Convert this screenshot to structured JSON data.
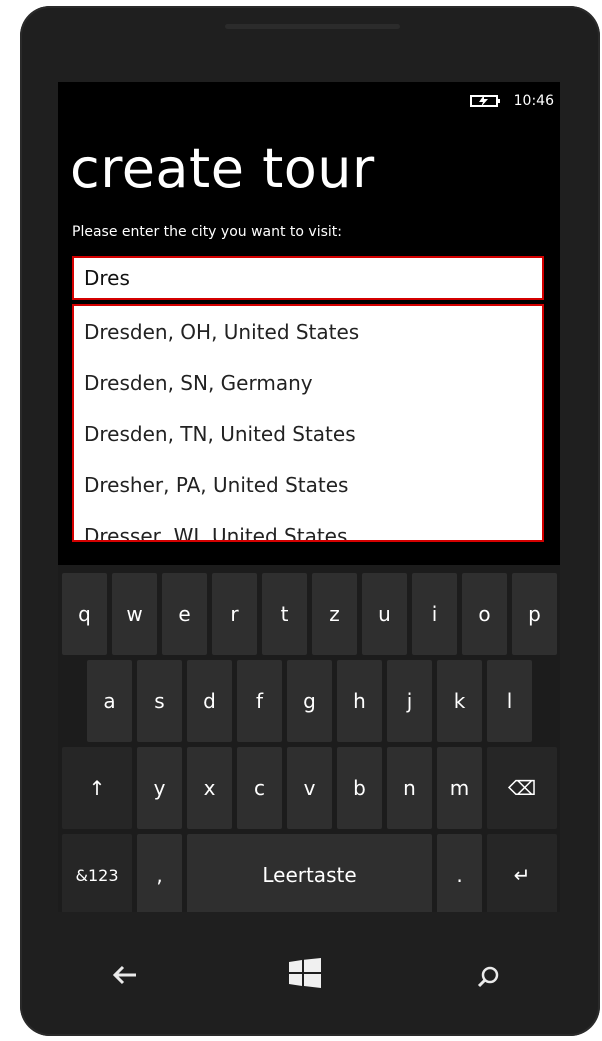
{
  "status": {
    "time": "10:46"
  },
  "page": {
    "title": "create tour",
    "prompt": "Please enter the city you want to visit:"
  },
  "search": {
    "value": "Dres"
  },
  "suggestions": [
    "Dresden, OH, United States",
    "Dresden, SN, Germany",
    "Dresden, TN, United States",
    "Dresher, PA, United States",
    "Dresser, WI, United States"
  ],
  "keyboard": {
    "row1": [
      "q",
      "w",
      "e",
      "r",
      "t",
      "z",
      "u",
      "i",
      "o",
      "p"
    ],
    "row2": [
      "a",
      "s",
      "d",
      "f",
      "g",
      "h",
      "j",
      "k",
      "l"
    ],
    "row3": [
      "y",
      "x",
      "c",
      "v",
      "b",
      "n",
      "m"
    ],
    "shift": "↑",
    "backspace": "⌫",
    "numbers": "&123",
    "comma": ",",
    "space": "Leertaste",
    "period": ".",
    "enter": "↵"
  },
  "nav": {
    "back_icon": "back-arrow-icon",
    "start_icon": "windows-logo-icon",
    "search_icon": "search-icon"
  }
}
